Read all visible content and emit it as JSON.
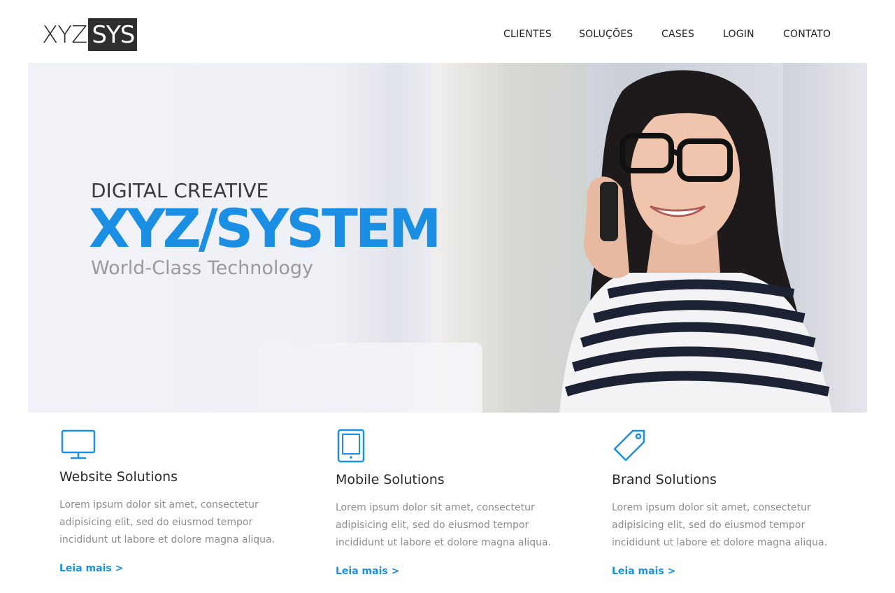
{
  "brand": {
    "logo_part1": "XYZ",
    "logo_part2": "SYS"
  },
  "nav": {
    "items": [
      {
        "label": "CLIENTES"
      },
      {
        "label": "SOLUÇÕES"
      },
      {
        "label": "CASES"
      },
      {
        "label": "LOGIN"
      },
      {
        "label": "CONTATO"
      }
    ]
  },
  "hero": {
    "eyebrow": "DIGITAL CREATIVE",
    "headline": "XYZ/SYSTEM",
    "tagline": "World-Class Technology"
  },
  "features": [
    {
      "icon": "monitor-icon",
      "title": "Website Solutions",
      "description": "Lorem ipsum dolor sit amet, consectetur adipisicing elit, sed do eiusmod tempor incididunt ut labore et dolore magna aliqua.",
      "link": "Leia mais >"
    },
    {
      "icon": "tablet-icon",
      "title": "Mobile Solutions",
      "description": "Lorem ipsum dolor sit amet, consectetur adipisicing elit, sed do eiusmod tempor incididunt ut labore et dolore magna aliqua.",
      "link": "Leia mais >"
    },
    {
      "icon": "tag-icon",
      "title": "Brand Solutions",
      "description": "Lorem ipsum dolor sit amet, consectetur adipisicing elit, sed do eiusmod tempor incididunt ut labore et dolore magna aliqua.",
      "link": "Leia mais >"
    }
  ],
  "colors": {
    "accent": "#1a8fe3",
    "text": "#222222",
    "muted": "#8d8d8d",
    "logo_box": "#2f2f2f"
  }
}
